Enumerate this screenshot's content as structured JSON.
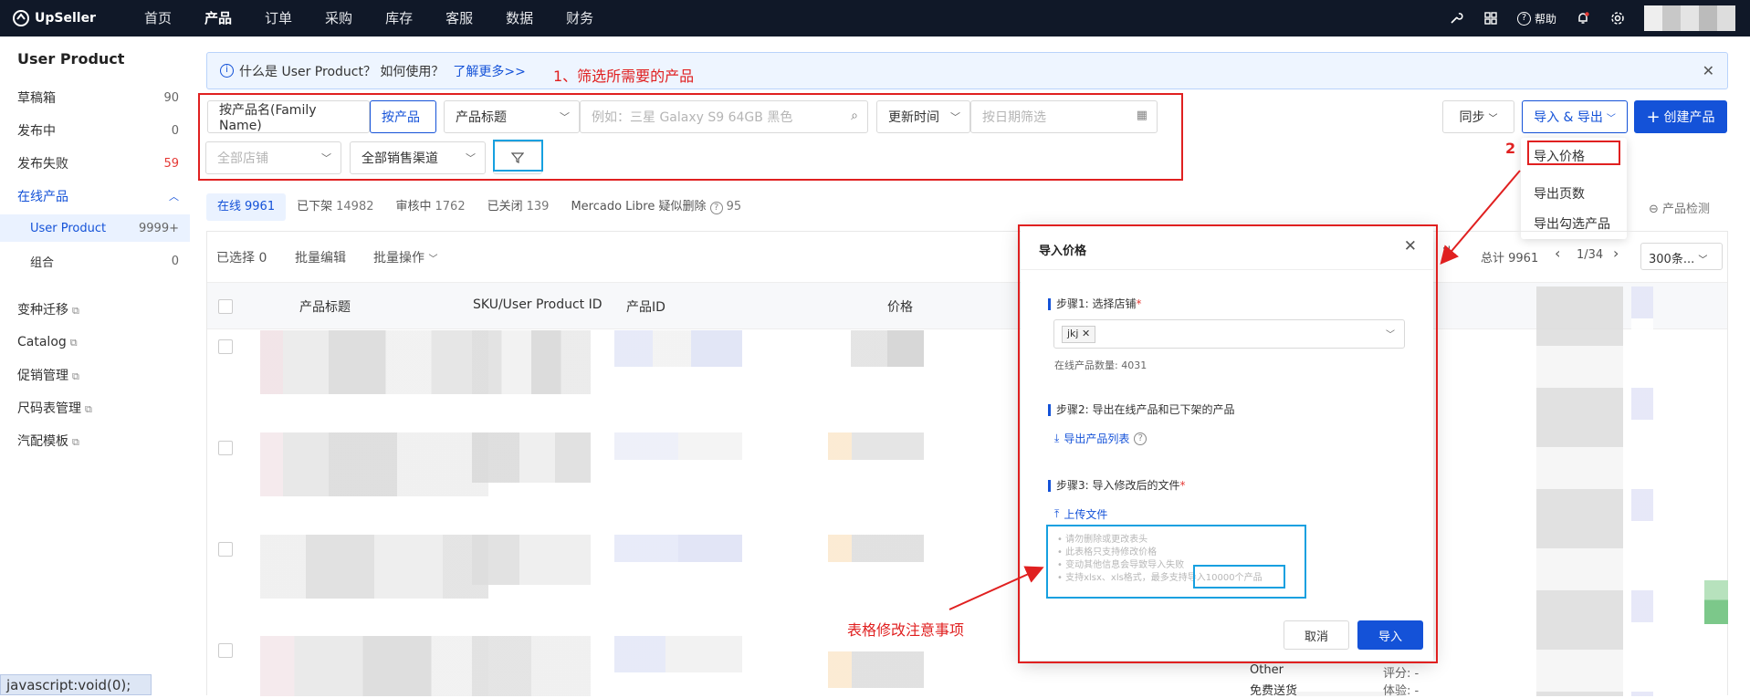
{
  "app": {
    "logo": "UpSeller"
  },
  "topnav": [
    "首页",
    "产品",
    "订单",
    "采购",
    "库存",
    "客服",
    "数据",
    "财务"
  ],
  "topbar": {
    "help": "帮助"
  },
  "sidebar": {
    "title": "User Product",
    "items": [
      {
        "label": "草稿箱",
        "count": "90"
      },
      {
        "label": "发布中",
        "count": "0"
      },
      {
        "label": "发布失败",
        "count": "59"
      },
      {
        "label": "在线产品",
        "count": ""
      },
      {
        "label": "User Product",
        "count": "9999+"
      },
      {
        "label": "组合",
        "count": "0"
      },
      {
        "label": "变种迁移",
        "count": ""
      },
      {
        "label": "Catalog",
        "count": ""
      },
      {
        "label": "促销管理",
        "count": ""
      },
      {
        "label": "尺码表管理",
        "count": ""
      },
      {
        "label": "汽配模板",
        "count": ""
      }
    ]
  },
  "banner": {
    "text": "什么是 User Product？ 如何使用？",
    "link": "了解更多>>"
  },
  "annotations": {
    "step1": "1、筛选所需要的产品",
    "step2": "2",
    "notes": "表格修改注意事项"
  },
  "filters": {
    "mode_family": "按产品名(Family Name)",
    "mode_product": "按产品",
    "field": "产品标题",
    "search_placeholder": "例如：三星 Galaxy S9 64GB 黑色",
    "time_field": "更新时间",
    "date_placeholder": "按日期筛选",
    "shop_placeholder": "全部店铺",
    "channel": "全部销售渠道"
  },
  "actions": {
    "sync": "同步",
    "import_export": "导入 & 导出",
    "create": "创建产品"
  },
  "menu": [
    "导入价格",
    "导出页数",
    "导出勾选产品"
  ],
  "tabs": [
    {
      "label": "在线",
      "count": "9961"
    },
    {
      "label": "已下架",
      "count": "14982"
    },
    {
      "label": "审核中",
      "count": "1762"
    },
    {
      "label": "已关闭",
      "count": "139"
    },
    {
      "label": "Mercado Libre 疑似删除",
      "count": "95"
    }
  ],
  "detect": "产品检测",
  "toolbar": {
    "selected": "已选择 0",
    "batch_edit": "批量编辑",
    "batch_ops": "批量操作"
  },
  "pager": {
    "total": "总计 9961",
    "page": "1/34",
    "size": "300条..."
  },
  "columns": [
    "产品标题",
    "SKU/User Product ID",
    "产品ID",
    "价格"
  ],
  "rowbits": {
    "other": "Other",
    "free_ship": "免费送货",
    "rating": "评分: -",
    "exp": "体验: -"
  },
  "modal": {
    "title": "导入价格",
    "step1": "步骤1: 选择店铺",
    "shop_chip": "jkj",
    "online_count": "在线产品数量: 4031",
    "step2": "步骤2: 导出在线产品和已下架的产品",
    "export_link": "导出产品列表",
    "step3": "步骤3: 导入修改后的文件",
    "upload": "上传文件",
    "notes": [
      "请勿删除或更改表头",
      "此表格只支持修改价格",
      "变动其他信息会导致导入失败",
      "支持xlsx、xls格式，最多支持导入10000个产品"
    ],
    "cancel": "取消",
    "import": "导入"
  },
  "status_tooltip": "javascript:void(0);"
}
